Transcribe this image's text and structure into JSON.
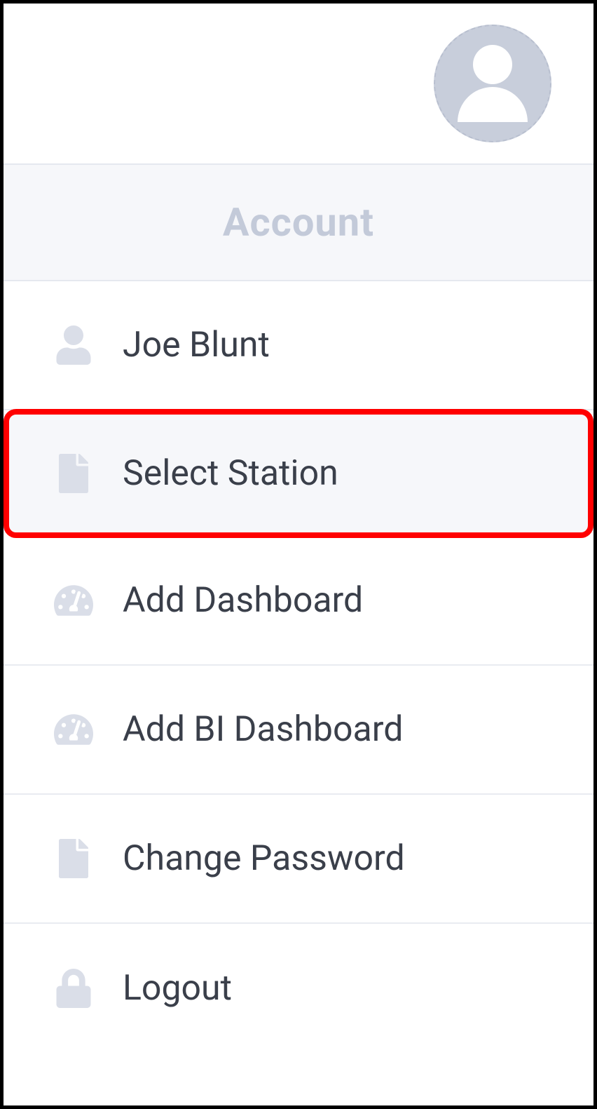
{
  "section_header": "Account",
  "menu": {
    "items": [
      {
        "label": "Joe Blunt",
        "icon": "user-icon",
        "highlighted": false
      },
      {
        "label": "Select Station",
        "icon": "file-icon",
        "highlighted": true
      },
      {
        "label": "Add Dashboard",
        "icon": "gauge-icon",
        "highlighted": false
      },
      {
        "label": "Add BI Dashboard",
        "icon": "gauge-icon",
        "highlighted": false
      },
      {
        "label": "Change Password",
        "icon": "file-icon",
        "highlighted": false
      },
      {
        "label": "Logout",
        "icon": "lock-icon",
        "highlighted": false
      }
    ]
  }
}
